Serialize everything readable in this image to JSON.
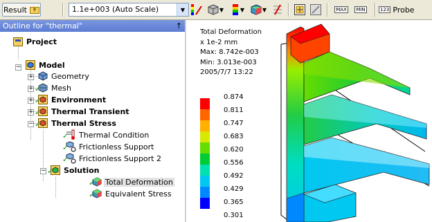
{
  "toolbar": {
    "result_label": "Result",
    "scale_value": "1.1e+003 (Auto Scale)",
    "max_label": "MAX",
    "min_label": "MIN",
    "probe_label": "Probe",
    "probe_icon_text": "123"
  },
  "outline": {
    "title": "Outline for \"thermal\"",
    "pin": "↑",
    "items": [
      {
        "label": "Project"
      },
      {
        "label": "Model"
      },
      {
        "label": "Geometry"
      },
      {
        "label": "Mesh"
      },
      {
        "label": "Environment"
      },
      {
        "label": "Thermal Transient"
      },
      {
        "label": "Thermal Stress"
      },
      {
        "label": "Thermal Condition"
      },
      {
        "label": "Frictionless Support"
      },
      {
        "label": "Frictionless Support 2"
      },
      {
        "label": "Solution"
      },
      {
        "label": "Total Deformation"
      },
      {
        "label": "Equivalent Stress"
      }
    ]
  },
  "result": {
    "title": "Total Deformation",
    "units": "x 1e-2 mm",
    "max": "Max: 8.742e-003",
    "min": "Min: 3.013e-003",
    "date": "2005/7/7 13:22",
    "legend": [
      {
        "value": "0.874",
        "color": "#ff0000"
      },
      {
        "value": "0.811",
        "color": "#ff6600"
      },
      {
        "value": "0.747",
        "color": "#ffb000"
      },
      {
        "value": "0.683",
        "color": "#d8e800"
      },
      {
        "value": "0.620",
        "color": "#66dd00"
      },
      {
        "value": "0.556",
        "color": "#00cc33"
      },
      {
        "value": "0.492",
        "color": "#00e0b0"
      },
      {
        "value": "0.429",
        "color": "#00c8f0"
      },
      {
        "value": "0.365",
        "color": "#0088ff"
      },
      {
        "value": "0.301",
        "color": "#0000ff"
      }
    ]
  }
}
